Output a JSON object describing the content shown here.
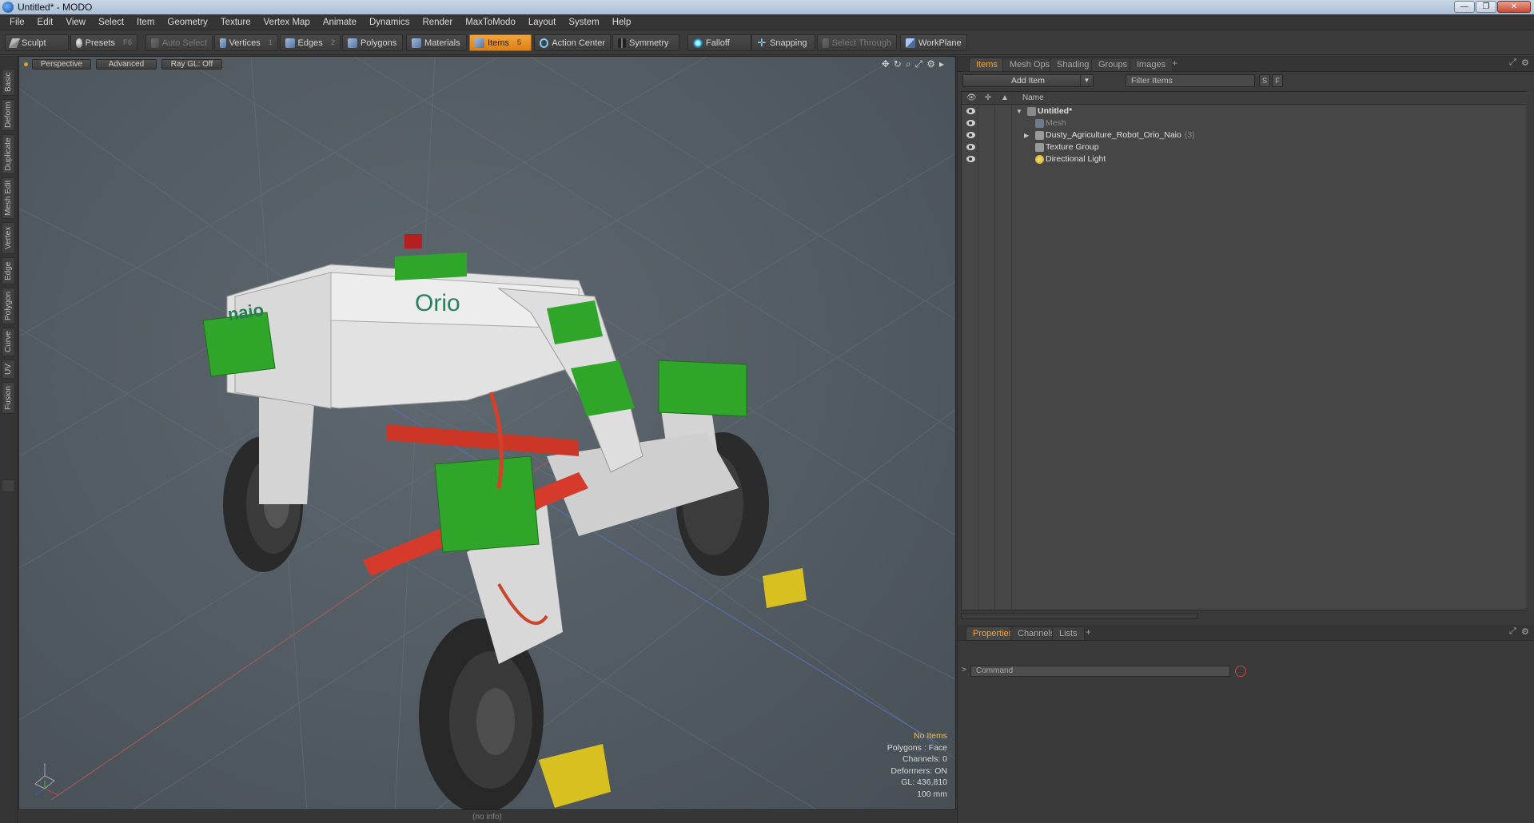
{
  "window": {
    "title": "Untitled* - MODO",
    "buttons": [
      "—",
      "❐",
      "✕"
    ]
  },
  "menu": [
    "File",
    "Edit",
    "View",
    "Select",
    "Item",
    "Geometry",
    "Texture",
    "Vertex Map",
    "Animate",
    "Dynamics",
    "Render",
    "MaxToModo",
    "Layout",
    "System",
    "Help"
  ],
  "toolbar": {
    "sculpt": "Sculpt",
    "presets": "Presets",
    "presets_key": "F6",
    "auto_select": "Auto Select",
    "vertices": "Vertices",
    "vertices_key": "1",
    "edges": "Edges",
    "edges_key": "2",
    "polygons": "Polygons",
    "materials": "Materials",
    "items": "Items",
    "items_key": "5",
    "action_center": "Action Center",
    "symmetry": "Symmetry",
    "falloff": "Falloff",
    "snapping": "Snapping",
    "select_through": "Select Through",
    "workplane": "WorkPlane"
  },
  "left_tabs": [
    "Basic",
    "Deform",
    "Duplicate",
    "Mesh Edit",
    "Vertex",
    "Edge",
    "Polygon",
    "Curve",
    "UV",
    "Fusion"
  ],
  "viewport": {
    "view": "Perspective",
    "mode": "Advanced",
    "raygl": "Ray GL: Off",
    "hud": {
      "selection": "No Items",
      "polygons": "Polygons : Face",
      "channels": "Channels: 0",
      "deformers": "Deformers: ON",
      "gl": "GL: 436,810",
      "scale": "100 mm"
    },
    "logo_text": "naio",
    "brand_text": "Orio"
  },
  "status": "(no info)",
  "right_panel": {
    "tabs": [
      "Items",
      "Mesh Ops",
      "Shading",
      "Groups",
      "Images"
    ],
    "active_tab": "Items",
    "add_item": "Add Item",
    "filter_placeholder": "Filter Items",
    "s_btn": "S",
    "f_btn": "F",
    "col_name": "Name",
    "tree": [
      {
        "label": "Untitled*",
        "bold": true
      },
      {
        "label": "Mesh",
        "muted": true
      },
      {
        "label": "Dusty_Agriculture_Robot_Orio_Naio",
        "count": "(3)"
      },
      {
        "label": "Texture Group"
      },
      {
        "label": "Directional Light"
      }
    ],
    "bottom_tabs": [
      "Properties",
      "Channels",
      "Lists"
    ],
    "command_placeholder": "Command",
    "command_prompt": ">"
  },
  "colors": {
    "accent": "#f2a33a",
    "robot_green": "#2fa52a",
    "robot_white": "#dcdcdc",
    "robot_red": "#d63a2a"
  }
}
